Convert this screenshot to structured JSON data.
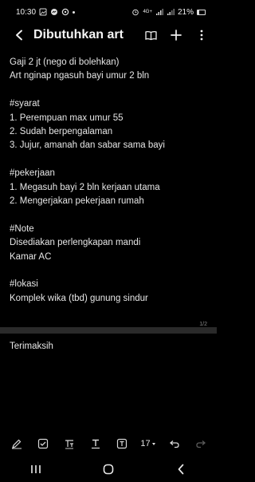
{
  "status_bar": {
    "time": "10:30",
    "signal_text": "4G+",
    "battery": "21%"
  },
  "app_bar": {
    "title": "Dibutuhkan art"
  },
  "note": {
    "lines": [
      "Gaji 2 jt (nego di bolehkan)",
      "Art nginap ngasuh bayi umur 2 bln",
      "",
      "#syarat",
      "1. Perempuan max umur 55",
      "2. Sudah berpengalaman",
      "3. Jujur, amanah dan sabar sama bayi",
      "",
      "#pekerjaan",
      "1. Megasuh bayi 2 bln kerjaan utama",
      "2. Mengerjakan pekerjaan rumah",
      "",
      "#Note",
      "Disediakan perlengkapan mandi",
      "Kamar AC",
      "",
      "#lokasi",
      "Komplek wika (tbd) gunung sindur"
    ],
    "page_indicator": "1/2",
    "page2_line": "Terimaksih"
  },
  "toolbar": {
    "font_size": "17"
  },
  "icons": {
    "back": "back-arrow-icon",
    "reading_mode": "book-icon",
    "add": "plus-icon",
    "more": "more-vert-icon"
  }
}
